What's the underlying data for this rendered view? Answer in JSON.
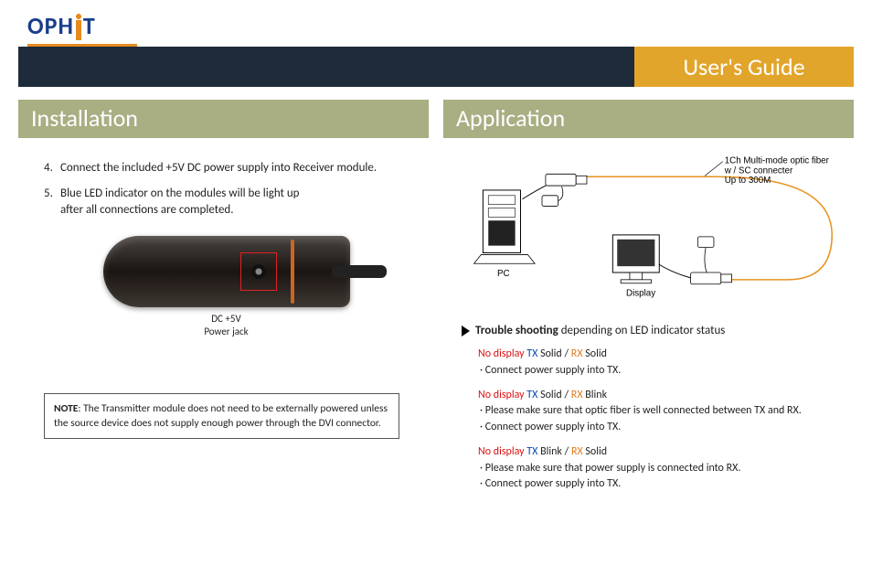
{
  "logo": {
    "text": "OPHIT"
  },
  "titleBar": {
    "right": "User's Guide"
  },
  "left": {
    "header": "Installation",
    "step4": {
      "num": "4.",
      "text": "Connect the included +5V DC power supply into Receiver module."
    },
    "step5": {
      "num": "5.",
      "text1": "Blue LED indicator on the modules will be light up",
      "text2": "after all connections are completed."
    },
    "photoLabel1": "DC +5V",
    "photoLabel2": "Power jack",
    "noteBold": "NOTE",
    "noteText": ": The Transmitter module does not need to be externally powered unless the source device does not supply enough power through the DVI connector."
  },
  "right": {
    "header": "Application",
    "diagram": {
      "fiberLabel1": "1Ch Multi-mode optic fiber",
      "fiberLabel2": "w / SC connecter",
      "fiberLabel3": "Up to 300M",
      "pcLabel": "PC",
      "displayLabel": "Display"
    },
    "tsHeader": {
      "bold": "Trouble shooting",
      "rest": " depending on LED indicator status"
    },
    "case1": {
      "title_nd": "No display",
      "tx": "TX",
      "txState": " Solid / ",
      "rx": "RX",
      "rxState": " Solid",
      "line1": "· Connect power supply into TX."
    },
    "case2": {
      "title_nd": "No display",
      "tx": "TX",
      "txState": " Solid / ",
      "rx": "RX",
      "rxState": " Blink",
      "line1": "· Please make sure that optic fiber is well connected between TX and RX.",
      "line2": "· Connect power supply into TX."
    },
    "case3": {
      "title_nd": "No display",
      "tx": "TX",
      "txState": " Blink / ",
      "rx": "RX",
      "rxState": " Solid",
      "line1": "· Please make sure that power supply is connected into RX.",
      "line2": "· Connect power supply into TX."
    }
  }
}
